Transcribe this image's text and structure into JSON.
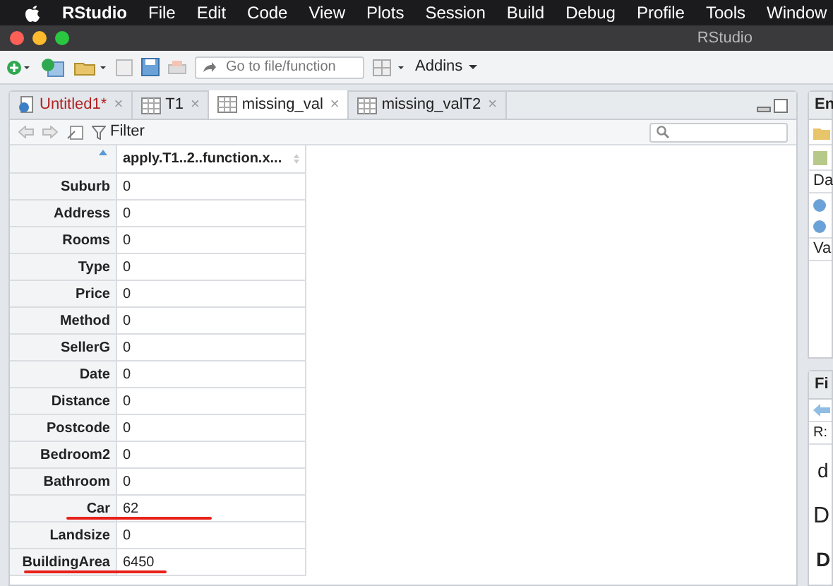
{
  "menu_bar": {
    "app": "RStudio",
    "items": [
      "File",
      "Edit",
      "Code",
      "View",
      "Plots",
      "Session",
      "Build",
      "Debug",
      "Profile",
      "Tools",
      "Window"
    ]
  },
  "window": {
    "title": "RStudio"
  },
  "toolbar": {
    "goto_placeholder": "Go to file/function",
    "addins": "Addins"
  },
  "tabs": [
    {
      "label": "Untitled1*",
      "close": "×",
      "kind": "script",
      "modified": true,
      "selected": false
    },
    {
      "label": "T1",
      "close": "×",
      "kind": "data",
      "modified": false,
      "selected": false
    },
    {
      "label": "missing_val",
      "close": "×",
      "kind": "data",
      "modified": false,
      "selected": true
    },
    {
      "label": "missing_valT2",
      "close": "×",
      "kind": "data",
      "modified": false,
      "selected": false
    }
  ],
  "viewer_toolbar": {
    "filter": "Filter"
  },
  "table": {
    "columns": [
      "apply.T1..2..function.x..."
    ],
    "rows": [
      {
        "name": "Suburb",
        "value": "0",
        "underlined": false
      },
      {
        "name": "Address",
        "value": "0",
        "underlined": false
      },
      {
        "name": "Rooms",
        "value": "0",
        "underlined": false
      },
      {
        "name": "Type",
        "value": "0",
        "underlined": false
      },
      {
        "name": "Price",
        "value": "0",
        "underlined": false
      },
      {
        "name": "Method",
        "value": "0",
        "underlined": false
      },
      {
        "name": "SellerG",
        "value": "0",
        "underlined": false
      },
      {
        "name": "Date",
        "value": "0",
        "underlined": false
      },
      {
        "name": "Distance",
        "value": "0",
        "underlined": false
      },
      {
        "name": "Postcode",
        "value": "0",
        "underlined": false
      },
      {
        "name": "Bedroom2",
        "value": "0",
        "underlined": false
      },
      {
        "name": "Bathroom",
        "value": "0",
        "underlined": false
      },
      {
        "name": "Car",
        "value": "62",
        "underlined": true
      },
      {
        "name": "Landsize",
        "value": "0",
        "underlined": false
      },
      {
        "name": "BuildingArea",
        "value": "6450",
        "underlined": true
      }
    ]
  },
  "right_pane": {
    "top_tab": "En",
    "top_label_1": "Da",
    "top_label_2": "Va",
    "bottom_tab": "Fi",
    "bottom_path": "R:",
    "bottom_text_1": "d",
    "bottom_text_2": "D",
    "bottom_text_3": "D"
  }
}
